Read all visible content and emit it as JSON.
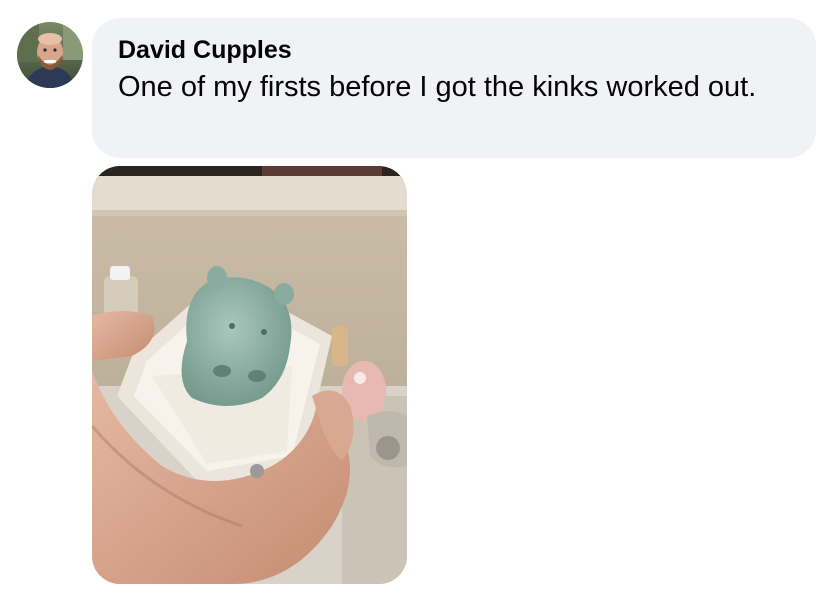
{
  "comment": {
    "author": "David Cupples",
    "text": "One of my firsts before I got the kinks worked out."
  },
  "icons": {
    "avatar": "profile-avatar",
    "photo": "attached-photo"
  },
  "colors": {
    "bubble_background": "#f0f2f5",
    "text": "#050505"
  }
}
